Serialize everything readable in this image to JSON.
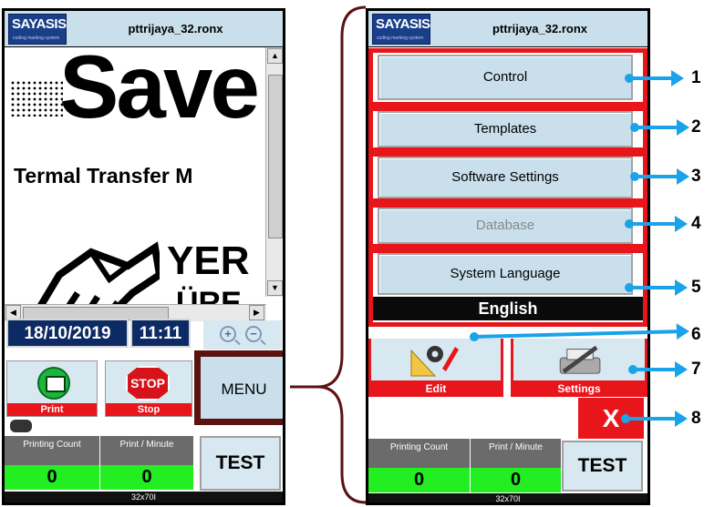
{
  "left_screen": {
    "logo_text": "SAYASIS",
    "logo_subtext": "coding marking system",
    "file_name": "pttrijaya_32.ronx",
    "preview": {
      "headline": "Save",
      "tagline": "Termal Transfer M",
      "word1": "YER",
      "word2": "ÜRE"
    },
    "date": "18/10/2019",
    "time": "11:11",
    "print_label": "Print",
    "stop_label": "Stop",
    "stop_sign_text": "STOP",
    "menu_label": "MENU",
    "test_label": "TEST",
    "printing_count_label": "Printing Count",
    "print_per_minute_label": "Print / Minute",
    "printing_count_value": "0",
    "print_per_minute_value": "0",
    "format_label": "32x70I"
  },
  "right_screen": {
    "logo_text": "SAYASIS",
    "logo_subtext": "coding marking system",
    "file_name": "pttrijaya_32.ronx",
    "menu": {
      "control": "Control",
      "templates": "Templates",
      "software_settings": "Software Settings",
      "database": "Database",
      "system_language": "System Language",
      "language_value": "English"
    },
    "edit_label": "Edit",
    "settings_label": "Settings",
    "close_label": "X",
    "test_label": "TEST",
    "printing_count_label": "Printing Count",
    "print_per_minute_label": "Print / Minute",
    "printing_count_value": "0",
    "print_per_minute_value": "0",
    "format_label": "32x70I"
  },
  "callouts": [
    "1",
    "2",
    "3",
    "4",
    "5",
    "6",
    "7",
    "8"
  ],
  "colors": {
    "callout_arrow": "#1aa3e8",
    "highlight_frame": "#e8151b",
    "menu_button": "#c9e0ec",
    "counter_green": "#23ee22",
    "date_bg": "#0c2a63",
    "bracket": "#5a1212"
  }
}
